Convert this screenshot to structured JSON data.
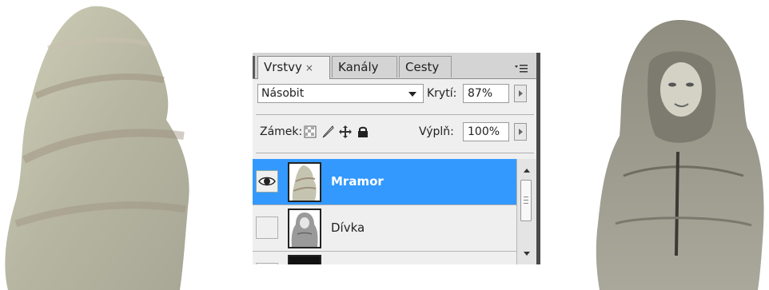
{
  "panel": {
    "tabs": [
      {
        "label": "Vrstvy",
        "close": "×",
        "active": true
      },
      {
        "label": "Kanály",
        "active": false
      },
      {
        "label": "Cesty",
        "active": false
      }
    ],
    "menu_icon": "panel-menu-icon"
  },
  "options": {
    "blend_mode": "Násobit",
    "opacity_label": "Krytí:",
    "opacity_value": "87%",
    "lock_label": "Zámek:",
    "fill_label": "Výplň:",
    "fill_value": "100%",
    "lock_icons": [
      "lock-transparency-icon",
      "lock-paint-icon",
      "lock-move-icon",
      "lock-all-icon"
    ]
  },
  "layers": [
    {
      "name": "Mramor",
      "visible": true,
      "selected": true
    },
    {
      "name": "Dívka",
      "visible": false,
      "selected": false
    },
    {
      "name": "",
      "visible": false,
      "selected": false
    }
  ],
  "colors": {
    "selection": "#3399ff",
    "panel_bg": "#efefef"
  }
}
